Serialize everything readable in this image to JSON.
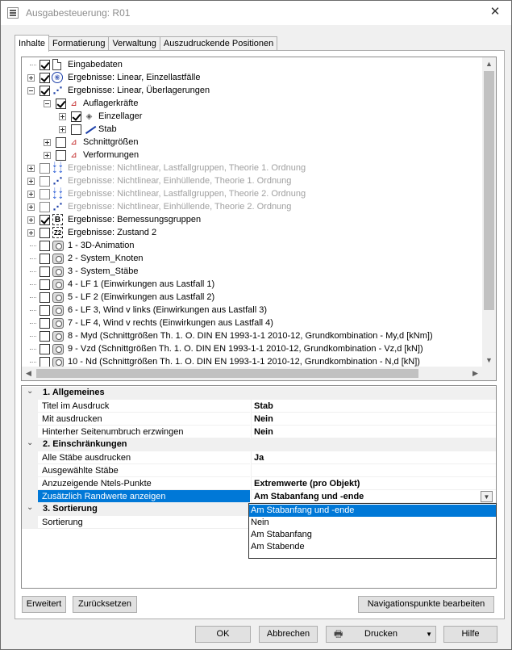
{
  "window": {
    "title": "Ausgabesteuerung: R01",
    "close_glyph": "✕"
  },
  "tabs": [
    {
      "label": "Inhalte"
    },
    {
      "label": "Formatierung"
    },
    {
      "label": "Verwaltung"
    },
    {
      "label": "Auszudruckende Positionen"
    }
  ],
  "tree": {
    "items": [
      {
        "label": "Eingabedaten"
      },
      {
        "label": "Ergebnisse: Linear, Einzellastfälle"
      },
      {
        "label": "Ergebnisse: Linear, Überlagerungen"
      },
      {
        "label": "Auflagerkräfte"
      },
      {
        "label": "Einzellager"
      },
      {
        "label": "Stab"
      },
      {
        "label": "Schnittgrößen"
      },
      {
        "label": "Verformungen"
      },
      {
        "label": "Ergebnisse: Nichtlinear, Lastfallgruppen, Theorie 1. Ordnung"
      },
      {
        "label": "Ergebnisse: Nichtlinear, Einhüllende, Theorie 1. Ordnung"
      },
      {
        "label": "Ergebnisse: Nichtlinear, Lastfallgruppen, Theorie 2. Ordnung"
      },
      {
        "label": "Ergebnisse: Nichtlinear, Einhüllende, Theorie 2. Ordnung"
      },
      {
        "label": "Ergebnisse: Bemessungsgruppen"
      },
      {
        "label": "Ergebnisse: Zustand 2"
      },
      {
        "label": "1 - 3D-Animation"
      },
      {
        "label": "2 - System_Knoten"
      },
      {
        "label": "3 - System_Stäbe"
      },
      {
        "label": "4 - LF 1 (Einwirkungen aus Lastfall 1)"
      },
      {
        "label": "5 - LF 2 (Einwirkungen aus Lastfall 2)"
      },
      {
        "label": "6 - LF 3, Wind v links (Einwirkungen aus Lastfall 3)"
      },
      {
        "label": "7 - LF 4, Wind v rechts (Einwirkungen aus Lastfall 4)"
      },
      {
        "label": "8 - Myd (Schnittgrößen Th. 1. O. DIN EN 1993-1-1 2010-12, Grundkombination - My,d [kNm])"
      },
      {
        "label": "9 - Vzd (Schnittgrößen Th. 1. O. DIN EN 1993-1-1 2010-12, Grundkombination - Vz,d [kN])"
      },
      {
        "label": "10 - Nd (Schnittgrößen Th. 1. O. DIN EN 1993-1-1 2010-12, Grundkombination - N,d [kN])"
      }
    ],
    "icon_text": {
      "circle": "⑥",
      "z2": "Z2",
      "b": "B"
    }
  },
  "properties": {
    "cat1": {
      "title": "1. Allgemeines"
    },
    "cat2": {
      "title": "2. Einschränkungen"
    },
    "cat3": {
      "title": "3. Sortierung"
    },
    "rows": [
      {
        "name": "Titel im Ausdruck",
        "value": "Stab"
      },
      {
        "name": "Mit ausdrucken",
        "value": "Nein"
      },
      {
        "name": "Hinterher Seitenumbruch erzwingen",
        "value": "Nein"
      },
      {
        "name": "Alle Stäbe ausdrucken",
        "value": "Ja"
      },
      {
        "name": "Ausgewählte Stäbe",
        "value": ""
      },
      {
        "name": "Anzuzeigende Ntels-Punkte",
        "value": "Extremwerte (pro Objekt)"
      },
      {
        "name": "Zusätzlich Randwerte anzeigen",
        "value": "Am Stabanfang und -ende"
      },
      {
        "name": "Sortierung",
        "value": ""
      }
    ],
    "dropdown_options": [
      {
        "label": "Am Stabanfang und -ende"
      },
      {
        "label": "Nein"
      },
      {
        "label": "Am Stabanfang"
      },
      {
        "label": "Am Stabende"
      }
    ]
  },
  "buttons": {
    "erweitert": "Erweitert",
    "zuruecksetzen": "Zurücksetzen",
    "navigation": "Navigationspunkte bearbeiten",
    "ok": "OK",
    "abbrechen": "Abbrechen",
    "drucken": "Drucken",
    "hilfe": "Hilfe"
  },
  "colors": {
    "selection": "#0078d7",
    "disabled_text": "#a0a0a0",
    "icon_blue": "#1c3fa8",
    "icon_red": "#c02020"
  }
}
